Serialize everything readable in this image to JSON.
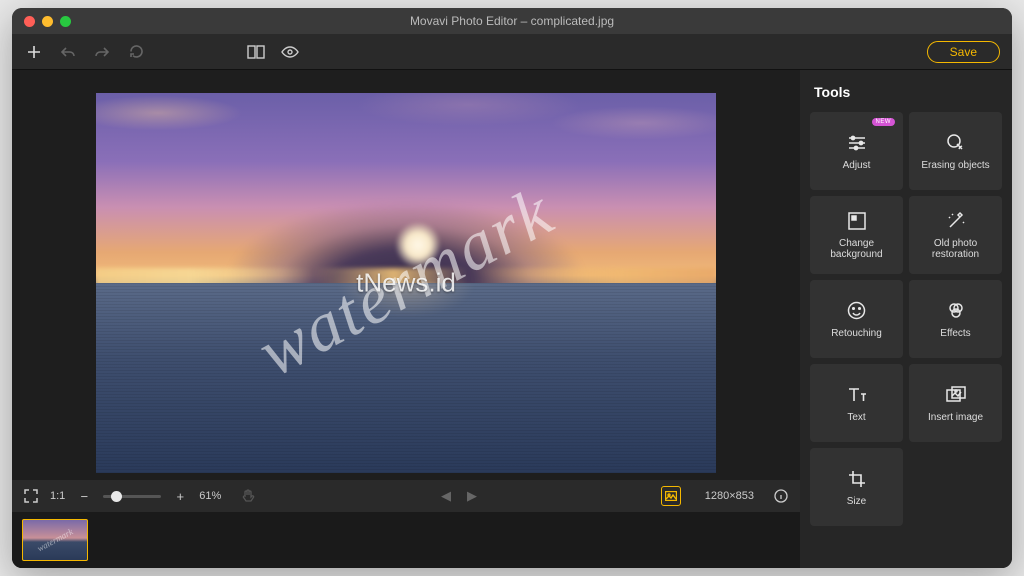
{
  "window": {
    "title": "Movavi Photo Editor – complicated.jpg"
  },
  "toolbar": {
    "save_label": "Save"
  },
  "canvas": {
    "watermark_main": "watermark",
    "watermark_overlay": "tNews.id"
  },
  "bottombar": {
    "ratio_label": "1:1",
    "zoom_minus": "−",
    "zoom_plus": "+",
    "zoom_percent": "61%",
    "dimensions": "1280×853"
  },
  "tools": {
    "heading": "Tools",
    "items": [
      {
        "label": "Adjust",
        "id": "adjust",
        "badge": "NEW"
      },
      {
        "label": "Erasing objects",
        "id": "erasing-objects"
      },
      {
        "label": "Change background",
        "id": "change-background"
      },
      {
        "label": "Old photo restoration",
        "id": "old-photo-restoration"
      },
      {
        "label": "Retouching",
        "id": "retouching"
      },
      {
        "label": "Effects",
        "id": "effects"
      },
      {
        "label": "Text",
        "id": "text"
      },
      {
        "label": "Insert image",
        "id": "insert-image"
      },
      {
        "label": "Size",
        "id": "size"
      }
    ]
  }
}
